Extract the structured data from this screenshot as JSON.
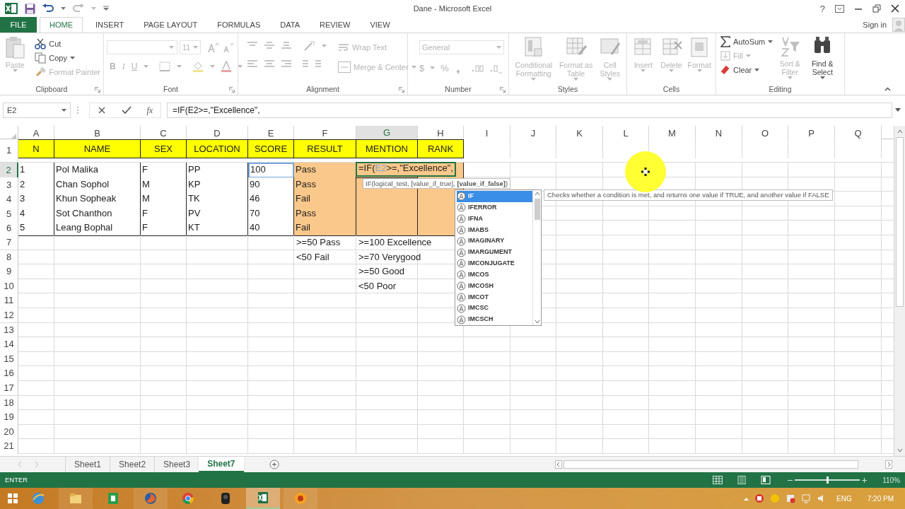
{
  "title_bar": {
    "title": "Dane - Microsoft Excel",
    "help": "?"
  },
  "ribbon_tabs": [
    {
      "label": "FILE",
      "kind": "file",
      "selected": false
    },
    {
      "label": "HOME",
      "kind": "tab",
      "selected": true
    },
    {
      "label": "INSERT",
      "kind": "tab",
      "selected": false
    },
    {
      "label": "PAGE LAYOUT",
      "kind": "tab",
      "selected": false
    },
    {
      "label": "FORMULAS",
      "kind": "tab",
      "selected": false
    },
    {
      "label": "DATA",
      "kind": "tab",
      "selected": false
    },
    {
      "label": "REVIEW",
      "kind": "tab",
      "selected": false
    },
    {
      "label": "VIEW",
      "kind": "tab",
      "selected": false
    }
  ],
  "account": {
    "label": "Sign in"
  },
  "ribbon": {
    "clipboard": {
      "label": "Clipboard",
      "paste": {
        "label": "Paste",
        "disabled": true
      },
      "cut": {
        "label": "Cut",
        "disabled": false
      },
      "copy": {
        "label": "Copy",
        "disabled": false
      },
      "format_painter": {
        "label": "Format Painter",
        "disabled": true
      }
    },
    "font": {
      "label": "Font",
      "size": "11",
      "style_buttons": [
        "B",
        "I",
        "U"
      ]
    },
    "alignment": {
      "label": "Alignment",
      "wrap_text": {
        "label": "Wrap Text",
        "disabled": true
      },
      "merge_center": {
        "label": "Merge & Center",
        "disabled": true
      }
    },
    "number": {
      "label": "Number",
      "format": "General",
      "currency": "$",
      "percent": "%"
    },
    "styles": {
      "label": "Styles",
      "buttons": [
        {
          "label": "Conditional Formatting",
          "disabled": true
        },
        {
          "label": "Format as Table",
          "disabled": true
        },
        {
          "label": "Cell Styles",
          "disabled": true
        }
      ]
    },
    "cells": {
      "label": "Cells",
      "buttons": [
        {
          "label": "Insert",
          "disabled": true
        },
        {
          "label": "Delete",
          "disabled": true
        },
        {
          "label": "Format",
          "disabled": true
        }
      ]
    },
    "editing": {
      "label": "Editing",
      "autosum": {
        "label": "AutoSum",
        "disabled": false
      },
      "fill": {
        "label": "Fill",
        "disabled": true
      },
      "clear": {
        "label": "Clear",
        "disabled": false
      },
      "sort_filter": {
        "label": "Sort & Filter",
        "disabled": true
      },
      "find_select": {
        "label": "Find & Select",
        "disabled": false
      }
    }
  },
  "formula_bar": {
    "name_box": "E2",
    "insert_function": "fx",
    "formula": "=IF(E2>=,\"Excellence\","
  },
  "sheet": {
    "columns": [
      {
        "label": "A",
        "selected": false
      },
      {
        "label": "B",
        "selected": false
      },
      {
        "label": "C",
        "selected": false
      },
      {
        "label": "D",
        "selected": false
      },
      {
        "label": "E",
        "selected": false
      },
      {
        "label": "F",
        "selected": false
      },
      {
        "label": "G",
        "selected": true
      },
      {
        "label": "H",
        "selected": false
      },
      {
        "label": "I",
        "selected": false
      },
      {
        "label": "J",
        "selected": false
      },
      {
        "label": "K",
        "selected": false
      },
      {
        "label": "L",
        "selected": false
      },
      {
        "label": "M",
        "selected": false
      },
      {
        "label": "N",
        "selected": false
      },
      {
        "label": "O",
        "selected": false
      },
      {
        "label": "P",
        "selected": false
      },
      {
        "label": "Q",
        "selected": false
      }
    ],
    "rows": [
      {
        "label": "1",
        "selected": false,
        "cells": [
          {
            "kind": "header",
            "text": "N"
          },
          {
            "kind": "header",
            "text": "NAME"
          },
          {
            "kind": "header",
            "text": "SEX"
          },
          {
            "kind": "header",
            "text": "LOCATION"
          },
          {
            "kind": "header",
            "text": "SCORE"
          },
          {
            "kind": "header",
            "text": "RESULT"
          },
          {
            "kind": "header",
            "text": "MENTION"
          },
          {
            "kind": "header",
            "text": "RANK"
          }
        ]
      },
      {
        "label": "2",
        "selected": true,
        "cells": [
          {
            "kind": "table",
            "text": "1"
          },
          {
            "kind": "table",
            "text": "Pol Malika"
          },
          {
            "kind": "table",
            "text": "F"
          },
          {
            "kind": "table",
            "text": "PP"
          },
          {
            "kind": "reference",
            "text": "100"
          },
          {
            "kind": "result",
            "text": "Pass"
          },
          {
            "kind": "editing",
            "before_reference": "=IF(",
            "reference": "E2",
            "after_reference": ">=,\"Excellence\","
          },
          {
            "kind": "result"
          }
        ]
      },
      {
        "label": "3",
        "selected": false,
        "cells": [
          {
            "kind": "table",
            "text": "2"
          },
          {
            "kind": "table",
            "text": "Chan Sophol"
          },
          {
            "kind": "table",
            "text": "M"
          },
          {
            "kind": "table",
            "text": "KP"
          },
          {
            "kind": "table",
            "text": "90"
          },
          {
            "kind": "result",
            "text": "Pass"
          },
          {
            "kind": "result"
          },
          {
            "kind": "result"
          }
        ]
      },
      {
        "label": "4",
        "selected": false,
        "cells": [
          {
            "kind": "table",
            "text": "3"
          },
          {
            "kind": "table",
            "text": "Khun Sopheak"
          },
          {
            "kind": "table",
            "text": "M"
          },
          {
            "kind": "table",
            "text": "TK"
          },
          {
            "kind": "table",
            "text": "46"
          },
          {
            "kind": "result",
            "text": "Fail"
          },
          {
            "kind": "result"
          },
          {
            "kind": "result"
          }
        ]
      },
      {
        "label": "5",
        "selected": false,
        "cells": [
          {
            "kind": "table",
            "text": "4"
          },
          {
            "kind": "table",
            "text": "Sot Chanthon"
          },
          {
            "kind": "table",
            "text": "F"
          },
          {
            "kind": "table",
            "text": "PV"
          },
          {
            "kind": "table",
            "text": "70"
          },
          {
            "kind": "result",
            "text": "Pass"
          },
          {
            "kind": "result"
          },
          {
            "kind": "result"
          }
        ]
      },
      {
        "label": "6",
        "selected": false,
        "cells": [
          {
            "kind": "table",
            "text": "5"
          },
          {
            "kind": "table",
            "text": "Leang Bophal"
          },
          {
            "kind": "table",
            "text": "F"
          },
          {
            "kind": "table",
            "text": "KT"
          },
          {
            "kind": "table",
            "text": "40"
          },
          {
            "kind": "result",
            "text": "Fail"
          },
          {
            "kind": "result"
          },
          {
            "kind": "result"
          }
        ]
      },
      {
        "label": "7",
        "selected": false,
        "cells": [
          {
            "kind": "plain"
          },
          {
            "kind": "plain"
          },
          {
            "kind": "plain"
          },
          {
            "kind": "plain"
          },
          {
            "kind": "plain"
          },
          {
            "kind": "plain",
            "text": ">=50 Pass"
          },
          {
            "kind": "plain",
            "text": ">=100 Excellence"
          }
        ]
      },
      {
        "label": "8",
        "selected": false,
        "cells": [
          {
            "kind": "plain"
          },
          {
            "kind": "plain"
          },
          {
            "kind": "plain"
          },
          {
            "kind": "plain"
          },
          {
            "kind": "plain"
          },
          {
            "kind": "plain",
            "text": "<50 Fail"
          },
          {
            "kind": "plain",
            "text": ">=70 Verygood"
          }
        ]
      },
      {
        "label": "9",
        "selected": false,
        "cells": [
          {
            "kind": "plain"
          },
          {
            "kind": "plain"
          },
          {
            "kind": "plain"
          },
          {
            "kind": "plain"
          },
          {
            "kind": "plain"
          },
          {
            "kind": "plain"
          },
          {
            "kind": "plain",
            "text": ">=50 Good"
          }
        ]
      },
      {
        "label": "10",
        "selected": false,
        "cells": [
          {
            "kind": "plain"
          },
          {
            "kind": "plain"
          },
          {
            "kind": "plain"
          },
          {
            "kind": "plain"
          },
          {
            "kind": "plain"
          },
          {
            "kind": "plain"
          },
          {
            "kind": "plain",
            "text": "<50 Poor"
          }
        ]
      },
      {
        "label": "11",
        "selected": false
      },
      {
        "label": "12",
        "selected": false
      },
      {
        "label": "13",
        "selected": false
      },
      {
        "label": "14",
        "selected": false
      },
      {
        "label": "15",
        "selected": false
      },
      {
        "label": "16",
        "selected": false
      },
      {
        "label": "17",
        "selected": false
      },
      {
        "label": "18",
        "selected": false
      },
      {
        "label": "19",
        "selected": false
      },
      {
        "label": "20",
        "selected": false
      },
      {
        "label": "21",
        "selected": false
      }
    ]
  },
  "autocomplete": {
    "signature": "IF(logical_test, [value_if_true], **[value_if_false]**)",
    "items": [
      {
        "label": "IF",
        "selected": true
      },
      {
        "label": "IFERROR",
        "selected": false
      },
      {
        "label": "IFNA",
        "selected": false
      },
      {
        "label": "IMABS",
        "selected": false
      },
      {
        "label": "IMAGINARY",
        "selected": false
      },
      {
        "label": "IMARGUMENT",
        "selected": false
      },
      {
        "label": "IMCONJUGATE",
        "selected": false
      },
      {
        "label": "IMCOS",
        "selected": false
      },
      {
        "label": "IMCOSH",
        "selected": false
      },
      {
        "label": "IMCOT",
        "selected": false
      },
      {
        "label": "IMCSC",
        "selected": false
      },
      {
        "label": "IMCSCH",
        "selected": false
      }
    ],
    "description": "Checks whether a condition is met, and returns one value if TRUE, and another value if FALSE"
  },
  "sheet_tabs": [
    {
      "label": "Sheet1",
      "selected": false
    },
    {
      "label": "Sheet2",
      "selected": false
    },
    {
      "label": "Sheet3",
      "selected": false
    },
    {
      "label": "Sheet7",
      "selected": true
    }
  ],
  "status_bar": {
    "mode": "ENTER",
    "zoom": "110%",
    "level": 0.5
  },
  "taskbar": {
    "language": "ENG",
    "time": "7:20 PM"
  }
}
